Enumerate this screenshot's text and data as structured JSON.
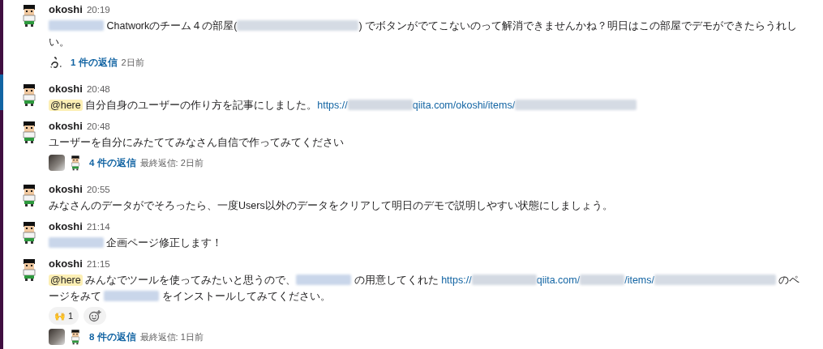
{
  "messages": [
    {
      "author": "okoshi",
      "time": "20:19",
      "body": [
        {
          "kind": "redacted_name"
        },
        {
          "kind": "text",
          "text": " Chatworkのチーム４の部屋("
        },
        {
          "kind": "redacted_url"
        },
        {
          "kind": "text",
          "text": ") でボタンがでてこないのって解消できませんかね？明日はこの部屋でデモができたらうれしい。"
        }
      ],
      "thread": {
        "avatars": [
          {
            "kind": "glyph"
          }
        ],
        "replies": "1 件の返信",
        "when": "2日前"
      }
    },
    {
      "author": "okoshi",
      "time": "20:48",
      "body": [
        {
          "kind": "mention",
          "text": "@here"
        },
        {
          "kind": "text",
          "text": " 自分自身のユーザーの作り方を記事にしました。"
        },
        {
          "kind": "link",
          "parts": [
            {
              "kind": "text",
              "text": "https://"
            },
            {
              "kind": "redacted_host"
            },
            {
              "kind": "text",
              "text": "qiita.com/okoshi/items/"
            },
            {
              "kind": "redacted_url"
            }
          ]
        }
      ]
    },
    {
      "author": "okoshi",
      "time": "20:48",
      "body": [
        {
          "kind": "text",
          "text": "ユーザーを自分にみたててみなさん自信で作ってみてください"
        }
      ],
      "thread": {
        "avatars": [
          {
            "kind": "photo"
          },
          {
            "kind": "boy"
          }
        ],
        "replies": "4 件の返信",
        "when": "最終返信: 2日前"
      }
    },
    {
      "author": "okoshi",
      "time": "20:55",
      "body": [
        {
          "kind": "text",
          "text": "みなさんのデータがでそろったら、一度Users以外のデータをクリアして明日のデモで説明しやすい状態にしましょう。"
        }
      ]
    },
    {
      "author": "okoshi",
      "time": "21:14",
      "body": [
        {
          "kind": "redacted_name"
        },
        {
          "kind": "text",
          "text": " 企画ページ修正します！"
        }
      ]
    },
    {
      "author": "okoshi",
      "time": "21:15",
      "body": [
        {
          "kind": "mention",
          "text": "@here"
        },
        {
          "kind": "text",
          "text": " みんなでツールを使ってみたいと思うので、"
        },
        {
          "kind": "redacted_name"
        },
        {
          "kind": "text",
          "text": " の用意してくれた "
        },
        {
          "kind": "link",
          "parts": [
            {
              "kind": "text",
              "text": "https://"
            },
            {
              "kind": "redacted_host"
            },
            {
              "kind": "text",
              "text": "qiita.com/"
            },
            {
              "kind": "redacted_path"
            },
            {
              "kind": "text",
              "text": "/items/"
            },
            {
              "kind": "redacted_url"
            }
          ]
        },
        {
          "kind": "text",
          "text": " のページをみて "
        },
        {
          "kind": "redacted_name"
        },
        {
          "kind": "text",
          "text": " をインストールしてみてください。"
        }
      ],
      "reactions": [
        {
          "emoji": "🙌",
          "count": "1"
        }
      ],
      "add_reaction": true,
      "thread": {
        "avatars": [
          {
            "kind": "photo"
          },
          {
            "kind": "boy"
          }
        ],
        "replies": "8 件の返信",
        "when": "最終返信: 1日前"
      }
    }
  ]
}
